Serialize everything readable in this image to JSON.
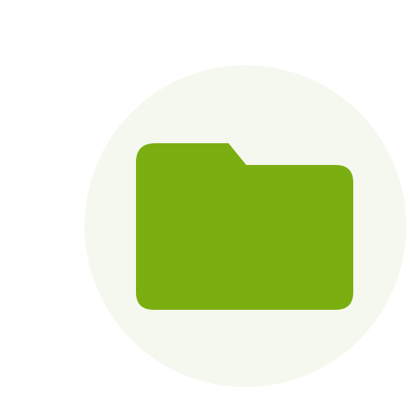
{
  "icon": {
    "name": "folder-icon",
    "colors": {
      "folder": "#7BAE11",
      "circle_background": "#F5F8EE",
      "page_background": "#FFFFFF"
    }
  }
}
